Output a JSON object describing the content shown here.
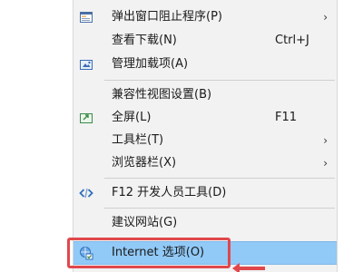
{
  "menu": {
    "items": [
      {
        "label": "弹出窗口阻止程序(P)",
        "shortcut": "",
        "submenu": true,
        "icon": "popup-blocker-icon"
      },
      {
        "label": "查看下载(N)",
        "shortcut": "Ctrl+J",
        "submenu": false,
        "icon": ""
      },
      {
        "label": "管理加载项(A)",
        "shortcut": "",
        "submenu": false,
        "icon": "manage-addons-icon"
      },
      {
        "label": "兼容性视图设置(B)",
        "shortcut": "",
        "submenu": false,
        "icon": ""
      },
      {
        "label": "全屏(L)",
        "shortcut": "F11",
        "submenu": false,
        "icon": "fullscreen-icon"
      },
      {
        "label": "工具栏(T)",
        "shortcut": "",
        "submenu": true,
        "icon": ""
      },
      {
        "label": "浏览器栏(X)",
        "shortcut": "",
        "submenu": true,
        "icon": ""
      },
      {
        "label": "F12 开发人员工具(D)",
        "shortcut": "",
        "submenu": false,
        "icon": "developer-tools-icon"
      },
      {
        "label": "建议网站(G)",
        "shortcut": "",
        "submenu": false,
        "icon": ""
      },
      {
        "label": "Internet 选项(O)",
        "shortcut": "",
        "submenu": false,
        "icon": "internet-options-icon",
        "highlighted": true
      }
    ],
    "arrow_glyph": "›"
  },
  "colors": {
    "highlight": "#91c9f7",
    "annotation": "#e0474c"
  }
}
